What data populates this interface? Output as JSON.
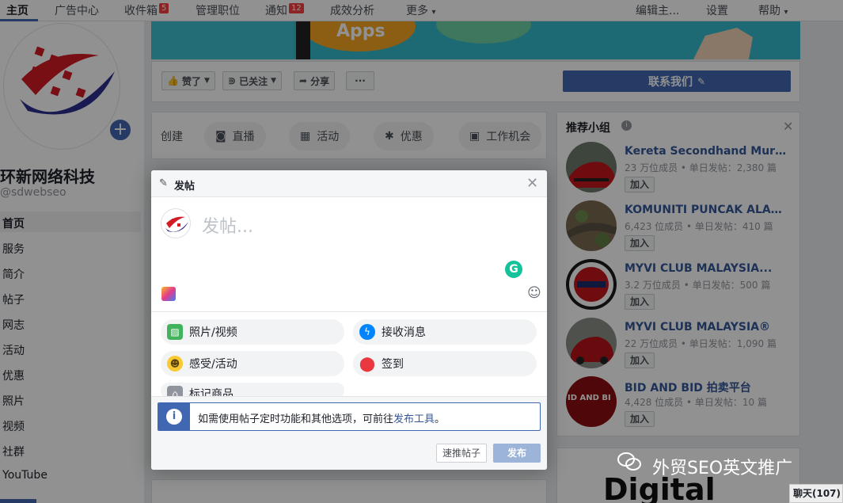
{
  "topnav": {
    "home": "主页",
    "ads": "广告中心",
    "inbox": "收件箱",
    "inbox_badge": "5",
    "roles": "管理职位",
    "notifications": "通知",
    "notifications_badge": "12",
    "insights": "成效分析",
    "more": "更多",
    "more_arrow": "▾",
    "edit": "编辑主...",
    "settings": "设置",
    "help": "帮助",
    "help_arrow": "▾"
  },
  "banner": {
    "apps_text": "Apps"
  },
  "page": {
    "name": "环新网络科技",
    "handle": "@sdwebseo",
    "nav": [
      "首页",
      "服务",
      "简介",
      "帖子",
      "网志",
      "活动",
      "优惠",
      "照片",
      "视频",
      "社群",
      "YouTube"
    ]
  },
  "actions": {
    "like": "赞了",
    "follow": "已关注",
    "share": "分享",
    "more": "···",
    "contact": "联系我们"
  },
  "create": {
    "label": "创建",
    "live": "直播",
    "event": "活动",
    "offer": "优惠",
    "job": "工作机会"
  },
  "suggested": {
    "title": "推荐小组",
    "groups": [
      {
        "name": "Kereta Secondhand Murah...",
        "meta": "23 万位成员 • 单日发帖：2,380 篇",
        "join": "加入"
      },
      {
        "name": "KOMUNITI PUNCAK ALAM...",
        "meta": "6,423 位成员 • 单日发帖：410 篇",
        "join": "加入"
      },
      {
        "name": "MYVI CLUB MALAYSIA...",
        "meta": "3.2 万位成员 • 单日发帖：500 篇",
        "join": "加入"
      },
      {
        "name": "MYVI CLUB MALAYSIA®",
        "meta": "22 万位成员 • 单日发帖：1,090 篇",
        "join": "加入"
      },
      {
        "name": "BID AND BID 拍卖平台",
        "meta": "4,428 位成员 • 单日发帖：10 篇",
        "join": "加入"
      }
    ],
    "avatar_text_5": "ID AND BI"
  },
  "bottom": {
    "digital": "Digital"
  },
  "composer": {
    "title": "发帖",
    "placeholder": "发帖...",
    "options": [
      {
        "label": "照片/视频"
      },
      {
        "label": "接收消息"
      },
      {
        "label": "感受/活动"
      },
      {
        "label": "签到"
      },
      {
        "label": "标记商品"
      }
    ],
    "info_text": "如需使用帖子定时功能和其他选项，可前往",
    "info_link": "发布工具",
    "info_end": "。",
    "boost": "速推帖子",
    "publish": "发布"
  },
  "chat": {
    "label": "聊天(107)"
  },
  "watermark": {
    "text": "外贸SEO英文推广"
  },
  "colors": {
    "fb_blue": "#4267b2",
    "link_blue": "#365899",
    "badge_red": "#fa3e3e",
    "publish_disabled": "#9cb4d8"
  }
}
